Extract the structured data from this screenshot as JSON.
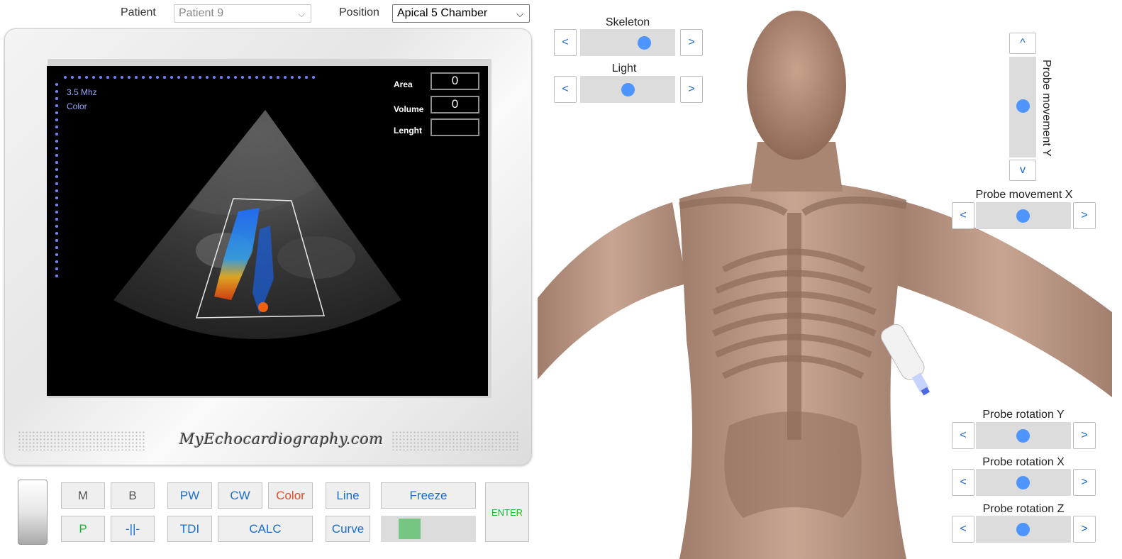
{
  "header": {
    "patient_label": "Patient",
    "patient_value": "Patient 9",
    "position_label": "Position",
    "position_value": "Apical 5 Chamber"
  },
  "screen": {
    "freq": "3.5 Mhz",
    "mode": "Color",
    "area_label": "Area",
    "area_value": "0",
    "volume_label": "Volume",
    "volume_value": "0",
    "length_label": "Lenght",
    "length_value": ""
  },
  "brand": "MyEchocardiography.com",
  "buttons": {
    "m": "M",
    "b": "B",
    "pw": "PW",
    "cw": "CW",
    "color": "Color",
    "line": "Line",
    "freeze": "Freeze",
    "enter": "ENTER",
    "p": "P",
    "bar": "-||-",
    "tdi": "TDI",
    "calc": "CALC",
    "curve": "Curve"
  },
  "controls": {
    "skeleton": "Skeleton",
    "light": "Light",
    "probe_y": "Probe movement Y",
    "probe_x": "Probe movement X",
    "rot_y": "Probe rotation Y",
    "rot_x": "Probe rotation X",
    "rot_z": "Probe rotation Z",
    "left": "<",
    "right": ">",
    "up": "^",
    "down": "v"
  },
  "colors": {
    "accent": "#1a6fd0",
    "knob": "#4e95ff",
    "color_btn": "#e24a2a",
    "green": "#22b339"
  }
}
